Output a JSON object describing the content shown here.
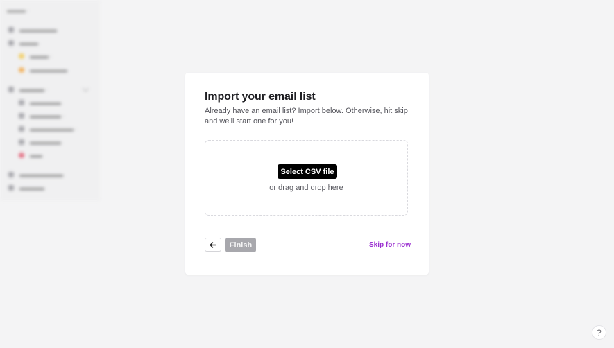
{
  "modal": {
    "title": "Import your email list",
    "description": "Already have an email list? Import below. Otherwise, hit skip and we'll start one for you!",
    "dropzone": {
      "select_label": "Select CSV file",
      "drag_text": "or drag and drop here"
    },
    "footer": {
      "back_icon": "arrow-left-icon",
      "finish_label": "Finish",
      "skip_label": "Skip for now"
    }
  },
  "help": {
    "label": "?"
  },
  "colors": {
    "accent": "#9b30d0",
    "primary_button": "#000000",
    "disabled_button": "#a8a8ad",
    "backdrop": "#f4f4f5"
  }
}
